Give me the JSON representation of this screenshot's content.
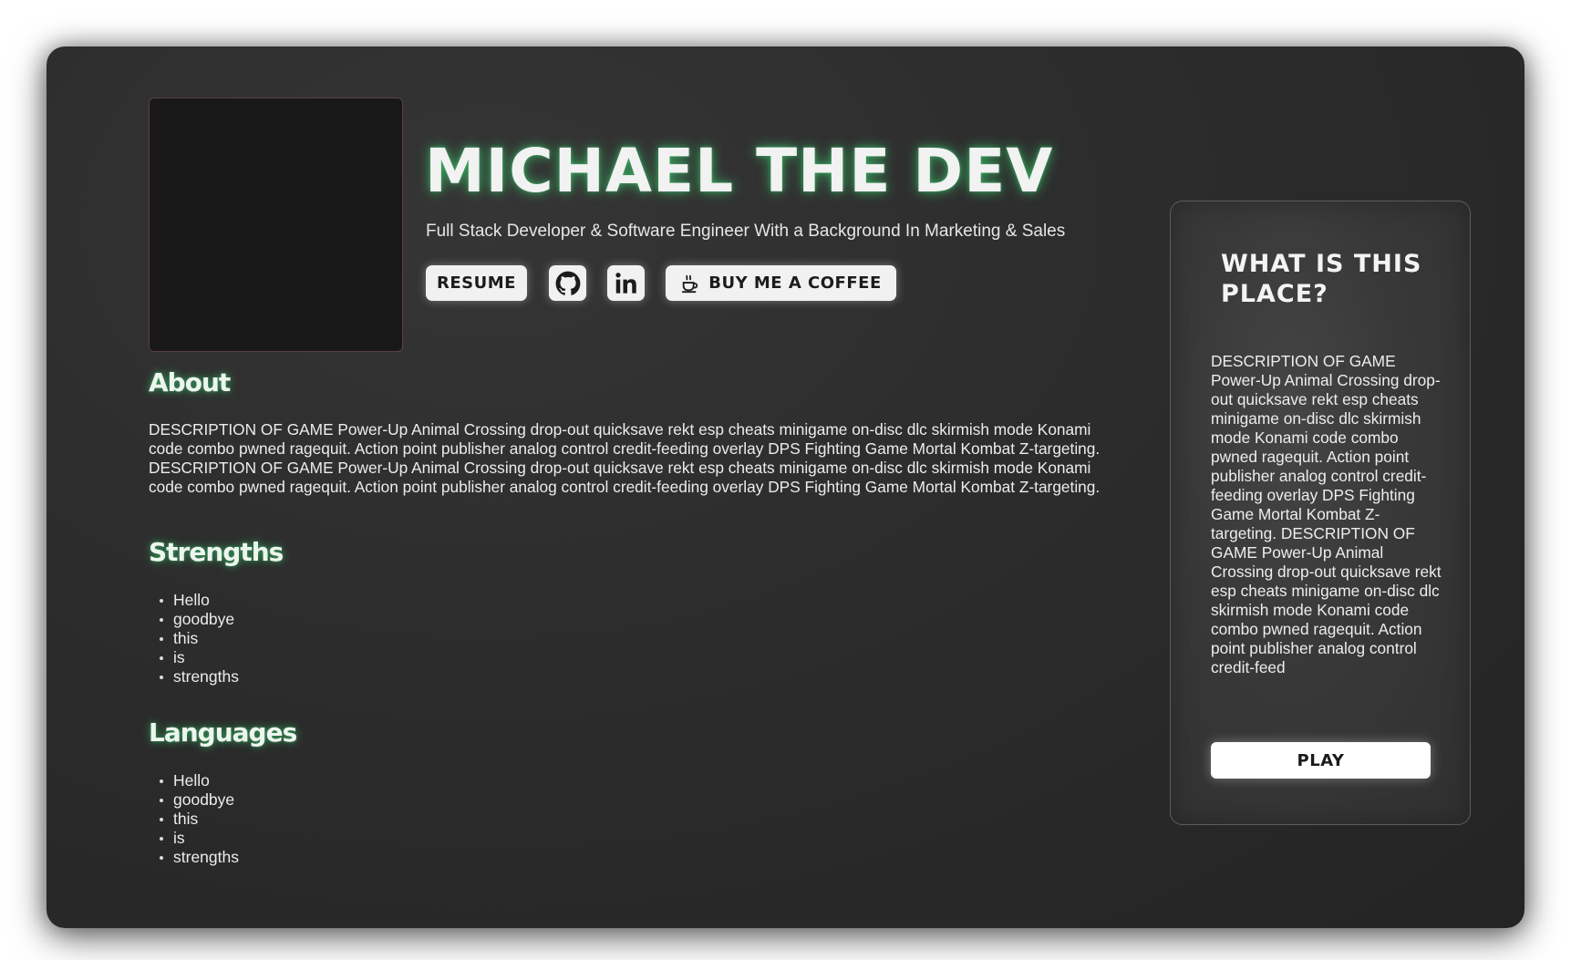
{
  "header": {
    "name": "MICHAEL THE DEV",
    "subtitle": "Full Stack Developer & Software Engineer With a Background In Marketing & Sales"
  },
  "links": {
    "resume_label": "RESUME",
    "github_icon": "github-icon",
    "linkedin_icon": "linkedin-icon",
    "coffee_label": "BUY ME A COFFEE",
    "coffee_icon": "coffee-cup-icon"
  },
  "about": {
    "title": "About",
    "text": "DESCRIPTION OF GAME Power-Up Animal Crossing drop-out quicksave rekt esp cheats minigame on-disc dlc skirmish mode Konami code combo pwned ragequit. Action point publisher analog control credit-feeding overlay DPS Fighting Game Mortal Kombat Z-targeting. DESCRIPTION OF GAME Power-Up Animal Crossing drop-out quicksave rekt esp cheats minigame on-disc dlc skirmish mode Konami code combo pwned ragequit. Action point publisher analog control credit-feeding overlay DPS Fighting Game Mortal Kombat Z-targeting."
  },
  "strengths": {
    "title": "Strengths",
    "items": [
      "Hello",
      "goodbye",
      "this",
      "is",
      "strengths"
    ]
  },
  "languages": {
    "title": "Languages",
    "items": [
      "Hello",
      "goodbye",
      "this",
      "is",
      "strengths"
    ]
  },
  "card": {
    "title": "WHAT IS THIS PLACE?",
    "text": "DESCRIPTION OF GAME Power-Up Animal Crossing drop-out quicksave rekt esp cheats minigame on-disc dlc skirmish mode Konami code combo pwned ragequit. Action point publisher analog control credit-feeding overlay DPS Fighting Game Mortal Kombat Z-targeting. DESCRIPTION OF GAME Power-Up Animal Crossing drop-out quicksave rekt esp cheats minigame on-disc dlc skirmish mode Konami code combo pwned ragequit. Action point publisher analog control credit-feed",
    "play_label": "PLAY"
  },
  "colors": {
    "background": "#2c2c2c",
    "glow": "#3cc86e",
    "button": "#f1f1f1",
    "text": "#ececec"
  }
}
